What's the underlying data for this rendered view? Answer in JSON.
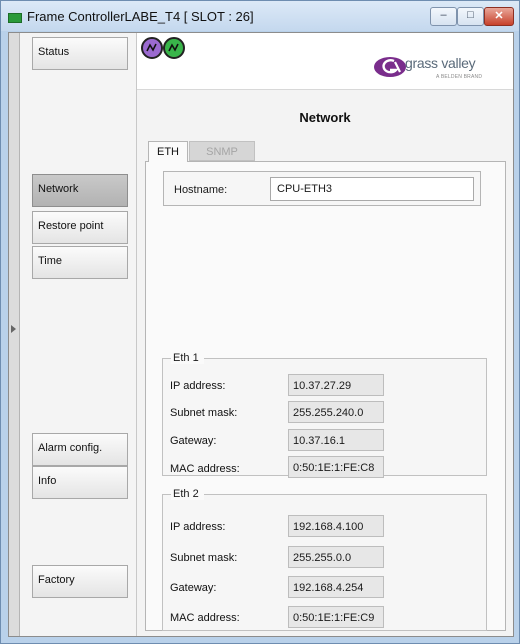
{
  "window": {
    "title": "Frame ControllerLABE_T4 [ SLOT : 26]",
    "controls": {
      "minimize": "–",
      "maximize": "□",
      "close": "✕"
    }
  },
  "sidebar": {
    "items": [
      {
        "label": "Status",
        "active": false
      },
      {
        "label": "Network",
        "active": true
      },
      {
        "label": "Restore point",
        "active": false
      },
      {
        "label": "Time",
        "active": false
      },
      {
        "label": "Alarm config.",
        "active": false
      },
      {
        "label": "Info",
        "active": false
      },
      {
        "label": "Factory",
        "active": false
      }
    ]
  },
  "header": {
    "status_indicators": [
      {
        "icon": "status-alarm-icon",
        "color": "#9b6ad0"
      },
      {
        "icon": "status-alarm-icon",
        "color": "#39b54a"
      }
    ],
    "logo": {
      "name": "grass valley",
      "sub": "A BELDEN BRAND",
      "mark_color": "#7a2d8c"
    }
  },
  "page": {
    "title": "Network",
    "tabs": [
      {
        "label": "ETH",
        "active": true
      },
      {
        "label": "SNMP",
        "active": false
      }
    ],
    "hostname": {
      "label": "Hostname:",
      "value": "CPU-ETH3"
    },
    "eth1": {
      "legend": "Eth 1",
      "rows": [
        {
          "label": "IP address:",
          "value": "10.37.27.29"
        },
        {
          "label": "Subnet mask:",
          "value": "255.255.240.0"
        },
        {
          "label": "Gateway:",
          "value": "10.37.16.1"
        },
        {
          "label": "MAC address:",
          "value": "0:50:1E:1:FE:C8"
        }
      ]
    },
    "eth2": {
      "legend": "Eth 2",
      "rows": [
        {
          "label": "IP address:",
          "value": "192.168.4.100"
        },
        {
          "label": "Subnet mask:",
          "value": "255.255.0.0"
        },
        {
          "label": "Gateway:",
          "value": "192.168.4.254"
        },
        {
          "label": "MAC address:",
          "value": "0:50:1E:1:FE:C9"
        }
      ]
    }
  }
}
